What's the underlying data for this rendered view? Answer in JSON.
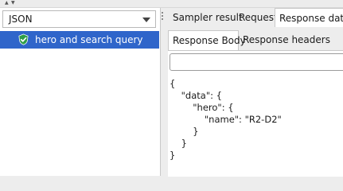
{
  "left_panel": {
    "view_selector": {
      "selected": "JSON"
    },
    "tree": [
      {
        "label": "hero and search query",
        "status": "success"
      }
    ]
  },
  "right_panel": {
    "main_tabs": [
      {
        "label": "Sampler result",
        "selected": false
      },
      {
        "label": "Request",
        "selected": false
      },
      {
        "label": "Response data",
        "selected": true
      }
    ],
    "sub_tabs": [
      {
        "label": "Response Body",
        "selected": true
      },
      {
        "label": "Response headers",
        "selected": false
      }
    ],
    "search": {
      "value": ""
    },
    "response_body": [
      "{",
      "    \"data\": {",
      "        \"hero\": {",
      "            \"name\": \"R2-D2\"",
      "        }",
      "    }",
      "}"
    ]
  },
  "colors": {
    "selection": "#2f65ca",
    "success": "#2e9d47"
  }
}
